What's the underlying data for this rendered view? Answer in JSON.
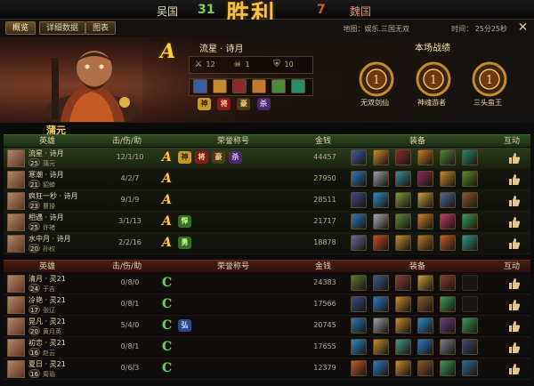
{
  "header": {
    "team_left": "吴国",
    "score_left": "31",
    "result": "胜利",
    "score_right": "7",
    "team_right": "魏国"
  },
  "tabs": [
    "概览",
    "详细数据",
    "图表"
  ],
  "info": {
    "map": "地图：娱乐.三国无双",
    "time": "时间：   25分25秒"
  },
  "banner": {
    "rank": "A",
    "hero_title": "流星 · 诗月",
    "hero_name": "蒲元",
    "kills": "12",
    "deaths": "1",
    "assists": "10",
    "stats_title": "本场战绩",
    "medals": [
      "无双剑仙",
      "神魂游者",
      "三头蛮王"
    ]
  },
  "table_headers": {
    "hero": "英雄",
    "kda": "击/伤/助",
    "honor": "荣誉称号",
    "gold": "金钱",
    "equip": "装备",
    "interact": "互动"
  },
  "colors": {
    "win": "#2f4a20",
    "lose": "#4a1d17",
    "rank_a": "#ffc438",
    "rank_c": "#6fcf4f"
  },
  "win_rows": [
    {
      "player": "流星 · 诗月",
      "hero": "蒲元",
      "level": "25",
      "kda": "12/1/10",
      "rank": "A",
      "gold": "44457",
      "honors": [
        "神",
        "将",
        "豪",
        "杀"
      ],
      "equip": [
        "#3a5fa8",
        "#c58a2a",
        "#8a2a2a",
        "#c57a2a",
        "#4a8a3a",
        "#2a8a6a"
      ]
    },
    {
      "player": "寒潮 · 诗月",
      "hero": "貂蝉",
      "level": "21",
      "kda": "4/2/7",
      "rank": "A",
      "gold": "27950",
      "honors": [],
      "equip": [
        "#2a78c5",
        "#9a9aa8",
        "#3a8a9a",
        "#8a2a5a",
        "#c58a2a",
        "#5a8a2a"
      ]
    },
    {
      "player": "疯狂一秒 · 诗月",
      "hero": "曹操",
      "level": "23",
      "kda": "9/1/9",
      "rank": "A",
      "gold": "28511",
      "honors": [],
      "equip": [
        "#3a4a8a",
        "#2a8ac5",
        "#7a9a3a",
        "#c5a03a",
        "#4a6a9a",
        "#8a5a2a"
      ]
    },
    {
      "player": "相遇 · 诗月",
      "hero": "许褚",
      "level": "25",
      "kda": "3/1/13",
      "rank": "A",
      "gold": "21717",
      "honors": [
        "悍"
      ],
      "equip": [
        "#2a78c5",
        "#a8a8b8",
        "#5a8a3a",
        "#c5802a",
        "#c53a6a",
        "#3a9a5a"
      ]
    },
    {
      "player": "水中月 · 诗月",
      "hero": "孙权",
      "level": "20",
      "kda": "2/2/16",
      "rank": "A",
      "gold": "18878",
      "honors": [
        "勇"
      ],
      "equip": [
        "#6a6a9a",
        "#c54a2a",
        "#c58a2a",
        "#b8782a",
        "#c55a2a",
        "#2a9a8a"
      ]
    }
  ],
  "lose_rows": [
    {
      "player": "清月 · 灵21",
      "hero": "于吉",
      "level": "24",
      "kda": "0/8/0",
      "rank": "C",
      "gold": "24383",
      "honors": [],
      "equip": [
        "#5a7a3a",
        "#3a5a8a",
        "#8a3a3a",
        "#c5a03a",
        "#8a3a2a",
        "empty"
      ]
    },
    {
      "player": "冷艳 · 灵21",
      "hero": "张辽",
      "level": "17",
      "kda": "0/8/1",
      "rank": "C",
      "gold": "17566",
      "honors": [],
      "equip": [
        "#3a4a8a",
        "#2a78c5",
        "#c58a2a",
        "#8a5a2a",
        "#3a9a5a",
        "empty"
      ]
    },
    {
      "player": "晃凡 · 灵21",
      "hero": "黄月英",
      "level": "20",
      "kda": "5/4/0",
      "rank": "C",
      "gold": "20745",
      "honors": [
        "弘"
      ],
      "equip": [
        "#2a78c5",
        "#9a9aa8",
        "#c58a2a",
        "#2a8ac5",
        "#6a3a8a",
        "#3a9a5a"
      ]
    },
    {
      "player": "初恋 · 灵21",
      "hero": "赵云",
      "level": "16",
      "kda": "0/8/1",
      "rank": "C",
      "gold": "17655",
      "honors": [],
      "equip": [
        "#2a8ac5",
        "#c58a2a",
        "#3a9a8a",
        "#2a78c5",
        "#7a7a8a",
        "#3a4a6a"
      ]
    },
    {
      "player": "夏日 · 灵21",
      "hero": "周瑜",
      "level": "16",
      "kda": "0/6/3",
      "rank": "C",
      "gold": "12379",
      "honors": [],
      "equip": [
        "#c55a2a",
        "#2a78c5",
        "#c58a2a",
        "#8a5a2a",
        "#3a9a5a",
        "#2a6a9a"
      ]
    }
  ]
}
